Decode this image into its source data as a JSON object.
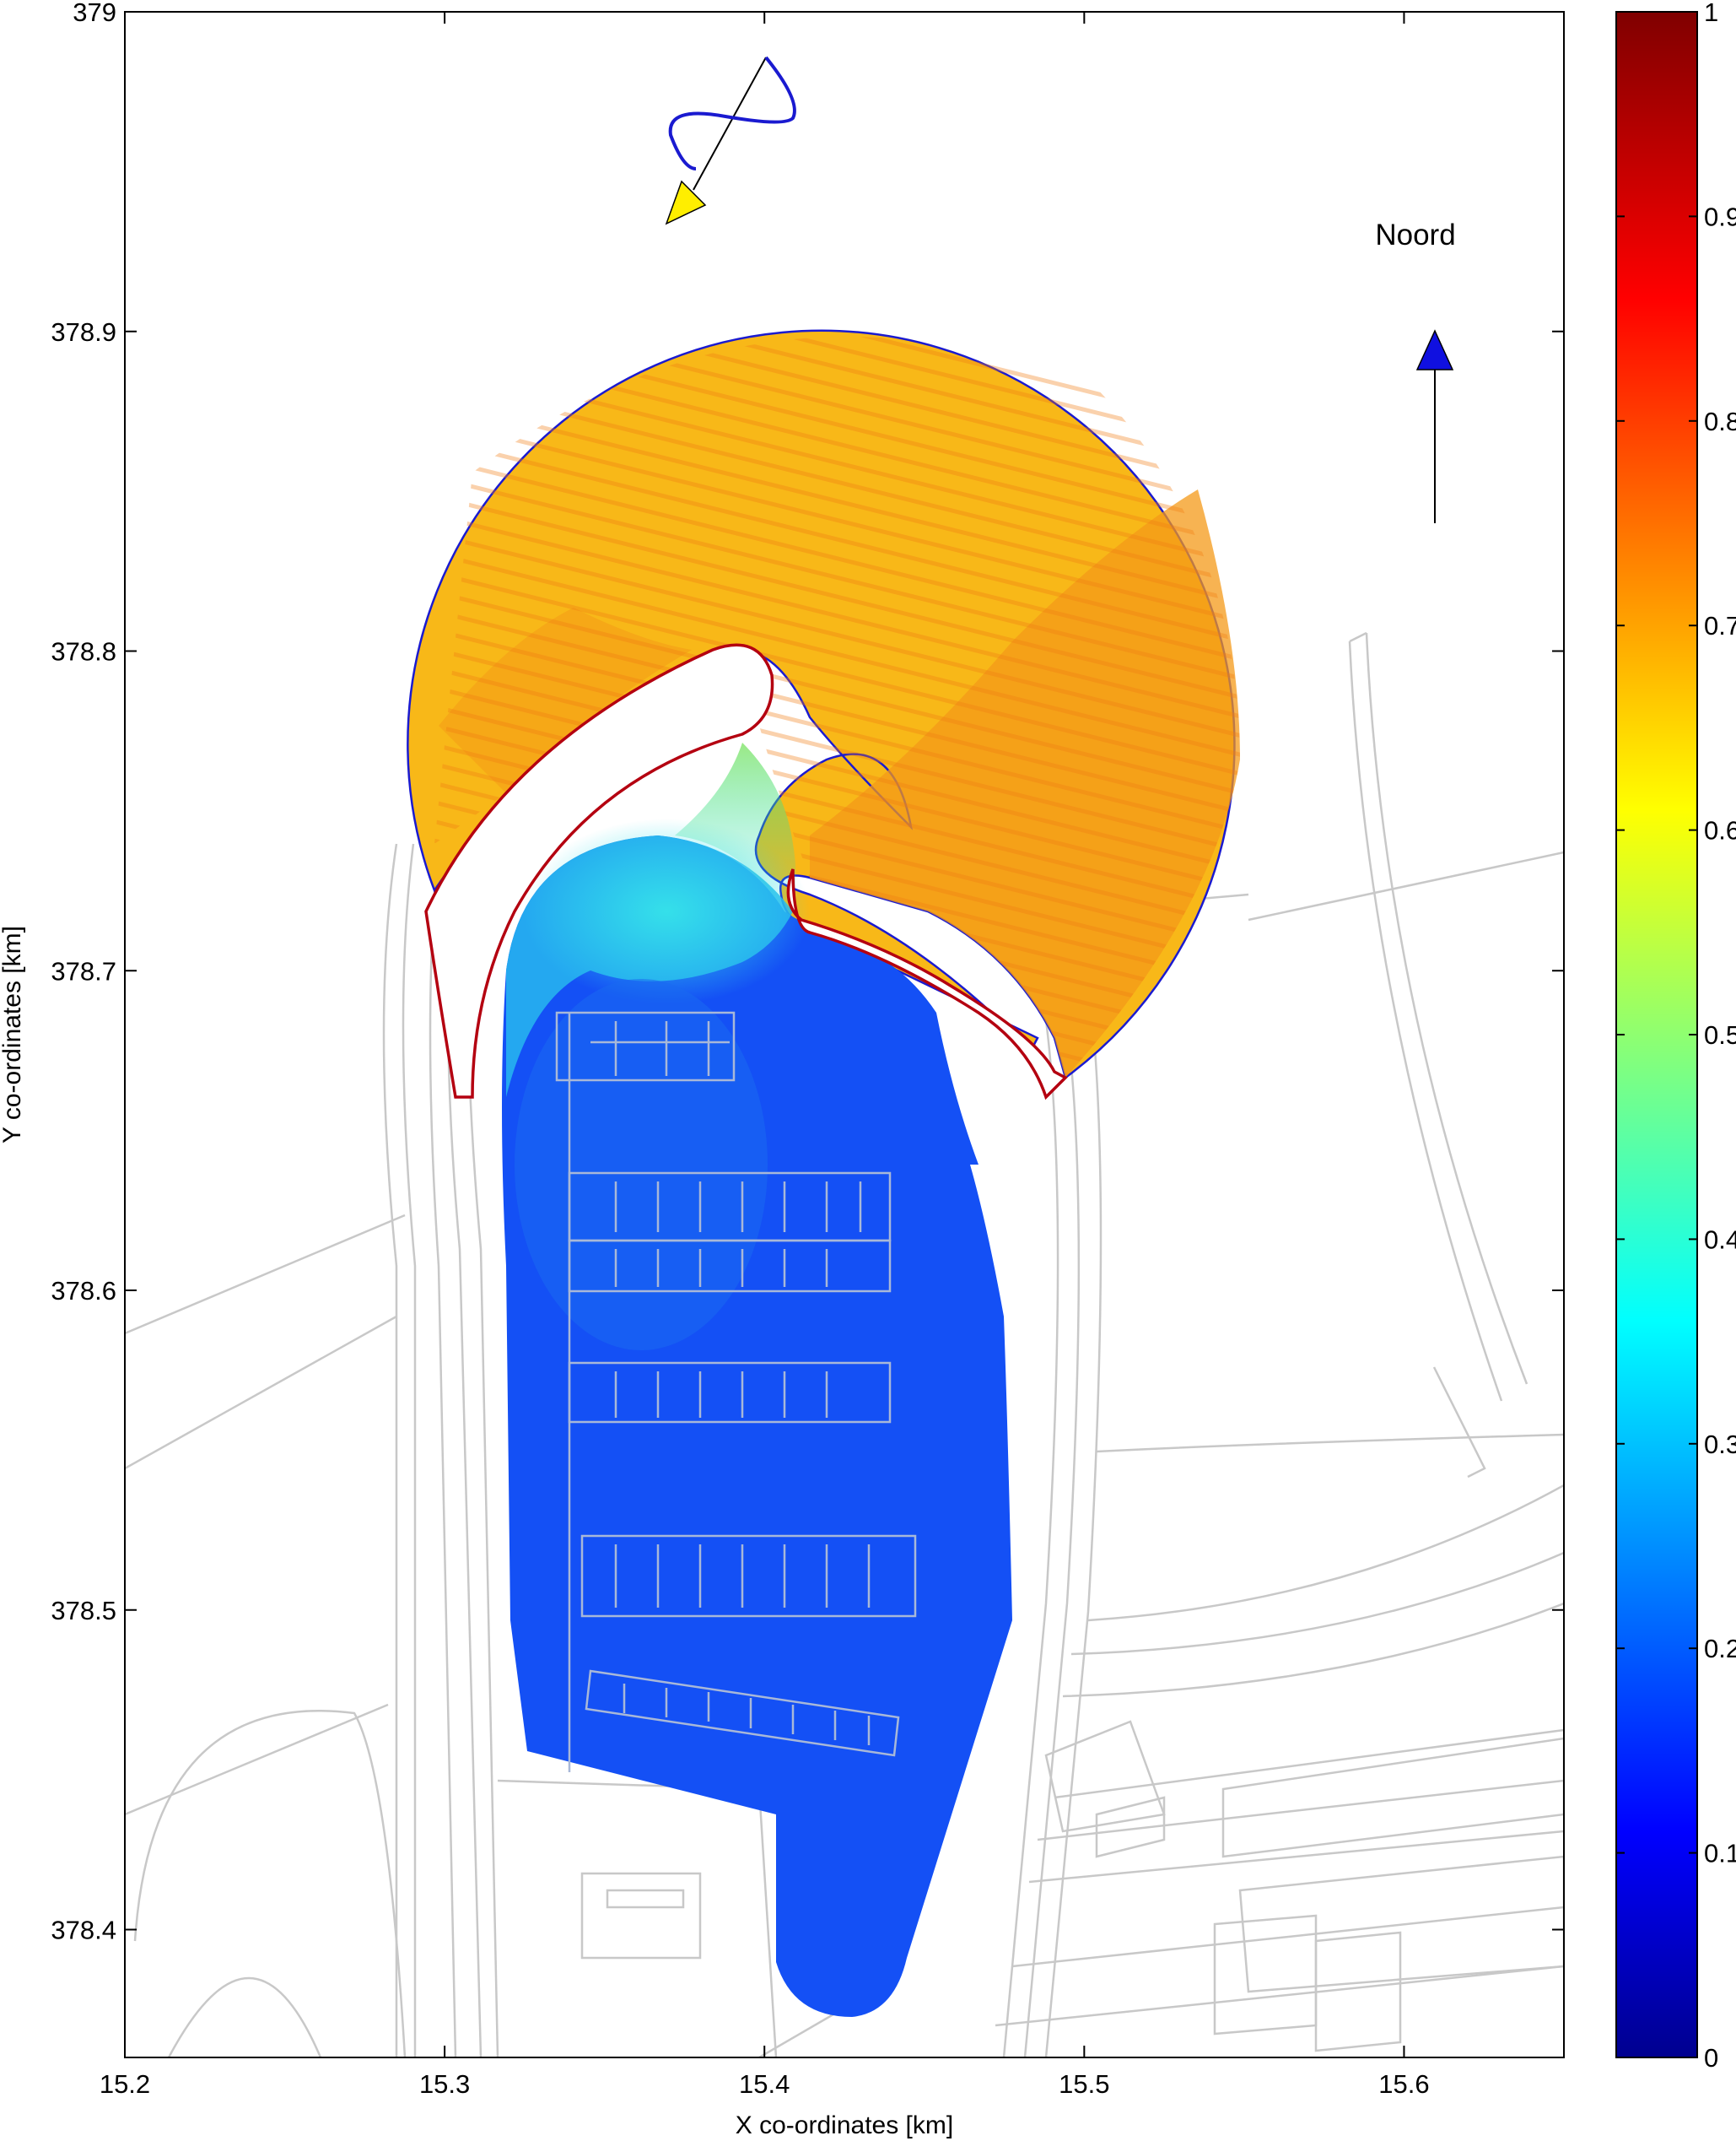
{
  "chart_data": {
    "type": "heatmap",
    "title": "",
    "xlabel": "X co-ordinates [km]",
    "ylabel": "Y co-ordinates [km]",
    "xlim": [
      15.2,
      15.65
    ],
    "ylim": [
      378.36,
      379.0
    ],
    "x_ticks": [
      15.2,
      15.3,
      15.4,
      15.5,
      15.6
    ],
    "x_tick_labels": [
      "15.2",
      "15.3",
      "15.4",
      "15.5",
      "15.6"
    ],
    "y_ticks": [
      378.4,
      378.5,
      378.6,
      378.7,
      378.8,
      378.9,
      379.0
    ],
    "y_tick_labels": [
      "378.4",
      "378.5",
      "378.6",
      "378.7",
      "378.8",
      "378.9",
      "379"
    ],
    "colorbar": {
      "range": [
        0,
        1
      ],
      "ticks": [
        0,
        0.1,
        0.2,
        0.3,
        0.4,
        0.5,
        0.6,
        0.7,
        0.8,
        0.9,
        1
      ],
      "tick_labels": [
        "0",
        "0.1",
        "0.2",
        "0.3",
        "0.4",
        "0.5",
        "0.6",
        "0.7",
        "0.8",
        "0.9",
        "1"
      ],
      "colormap": "jet"
    },
    "grid": false,
    "regions": [
      {
        "region": "outer circular sea domain",
        "value": 0.68
      },
      {
        "region": "wave shadow behind western breakwater head",
        "value": 0.6
      },
      {
        "region": "harbour entrance",
        "value": 0.35
      },
      {
        "region": "marina basin",
        "value": 0.12
      },
      {
        "region": "southern basin tip",
        "value": 0.1
      }
    ],
    "annotations": {
      "north_label": "Noord",
      "north_arrow_color": "#1010e0",
      "wave_direction_arrow_color": "#ffee00",
      "wave_spectrum_curve_color": "#1a1ad0"
    }
  }
}
